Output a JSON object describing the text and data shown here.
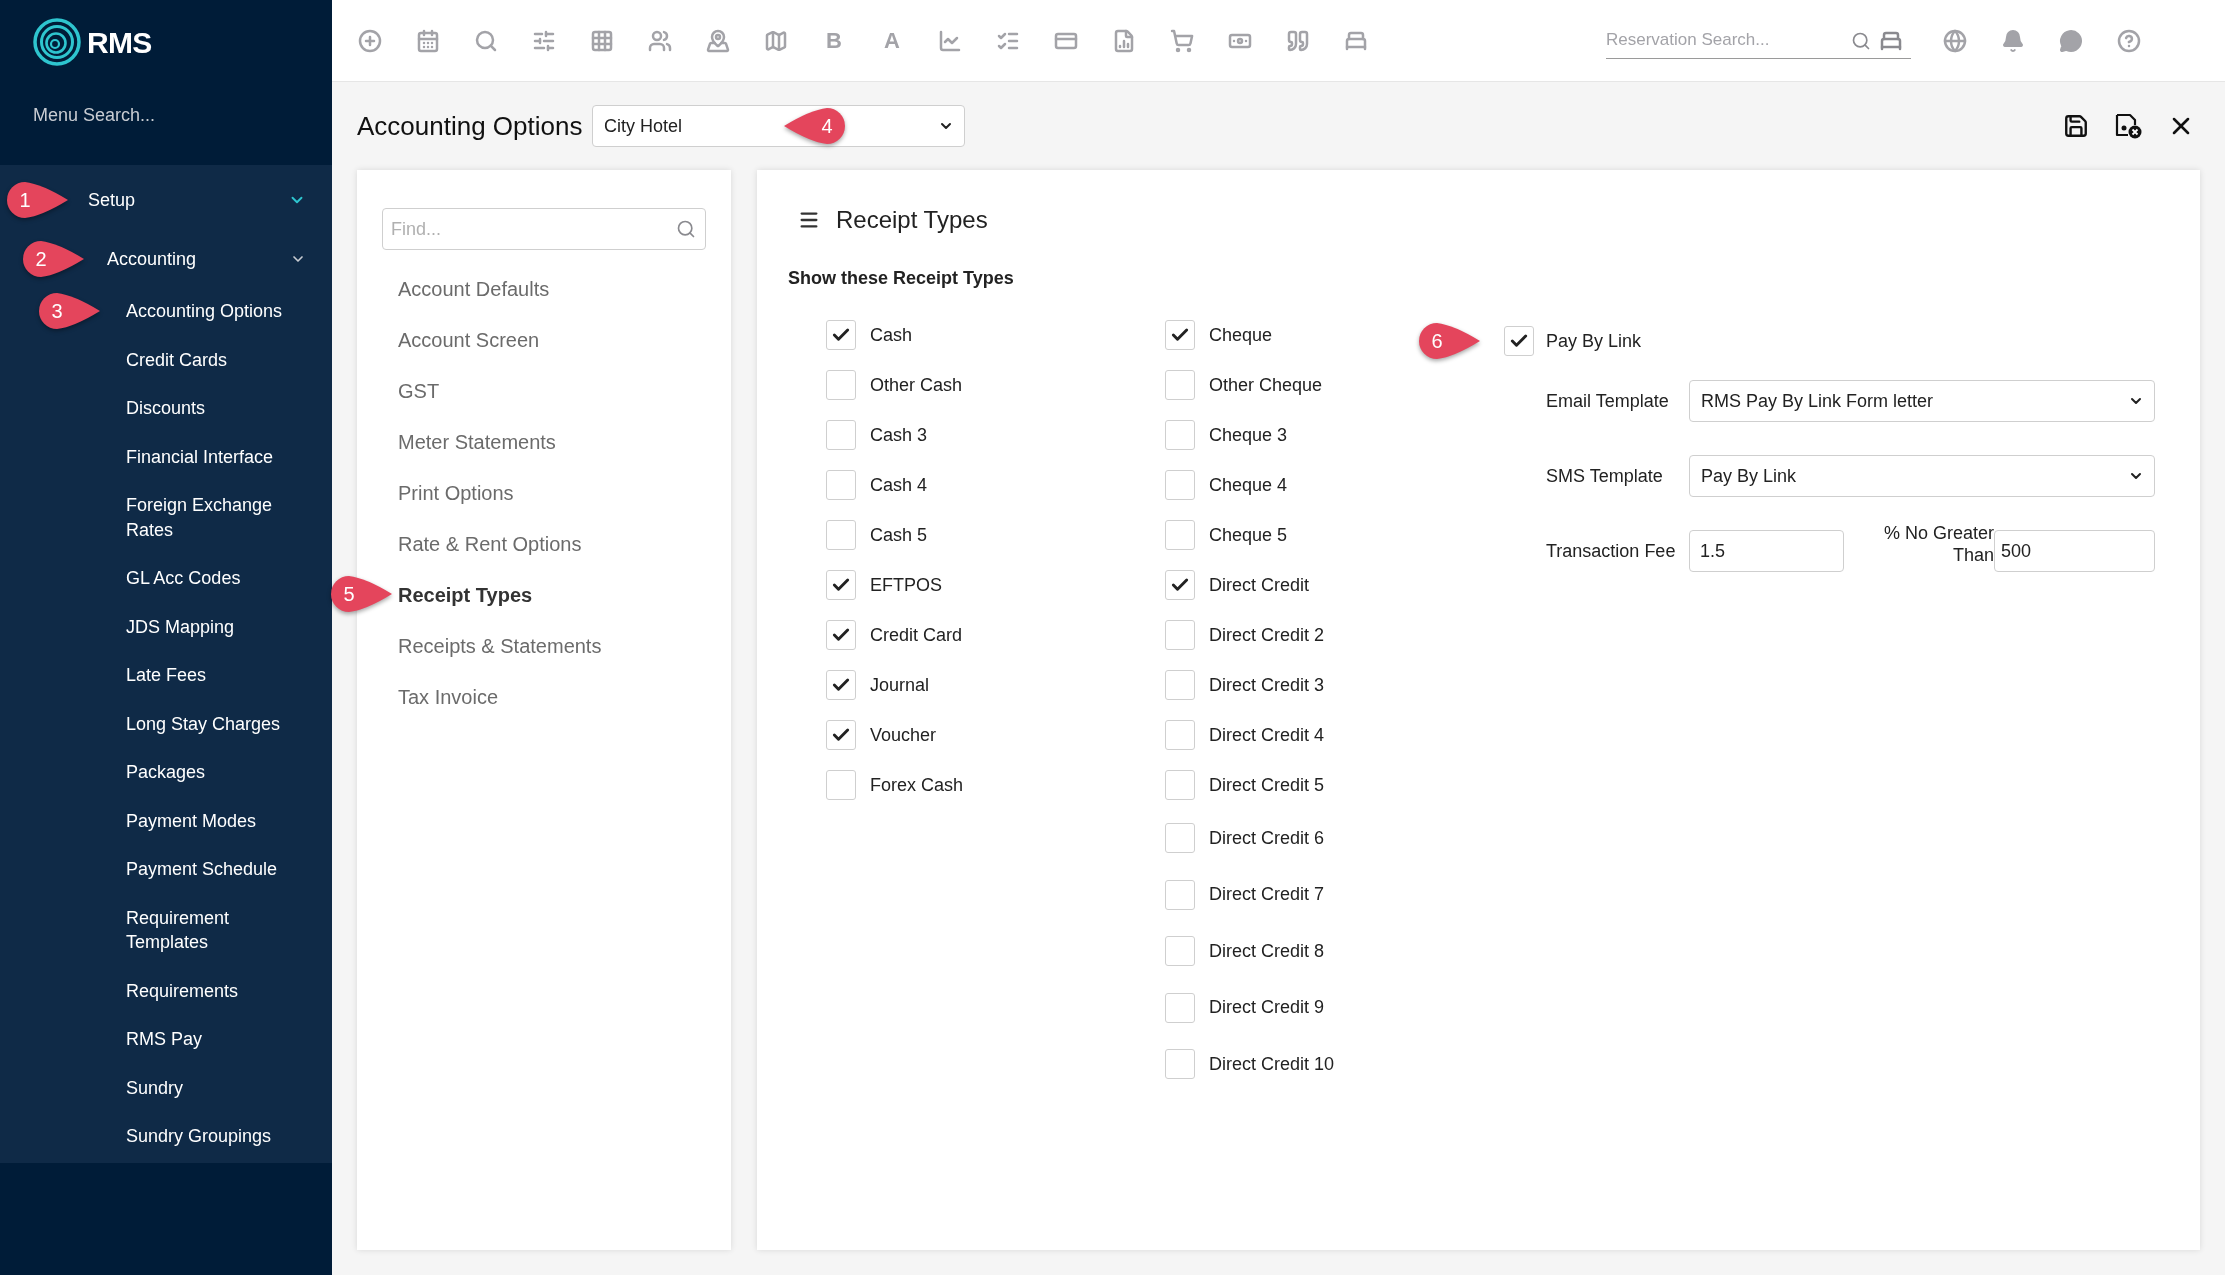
{
  "app": {
    "logo_text": "RMS",
    "menu_search": {
      "placeholder": "Menu Search..."
    }
  },
  "sidebar": {
    "items": [
      {
        "label": "Setup",
        "expanded": true,
        "callout": "1",
        "children": [
          {
            "label": "Accounting",
            "expanded": true,
            "callout": "2",
            "children": [
              {
                "label": "Accounting Options",
                "callout": "3"
              },
              {
                "label": "Credit Cards"
              },
              {
                "label": "Discounts"
              },
              {
                "label": "Financial Interface"
              },
              {
                "label": "Foreign Exchange Rates"
              },
              {
                "label": "GL Acc Codes"
              },
              {
                "label": "JDS Mapping"
              },
              {
                "label": "Late Fees"
              },
              {
                "label": "Long Stay Charges"
              },
              {
                "label": "Packages"
              },
              {
                "label": "Payment Modes"
              },
              {
                "label": "Payment Schedule"
              },
              {
                "label": "Requirement Templates"
              },
              {
                "label": "Requirements"
              },
              {
                "label": "RMS Pay"
              },
              {
                "label": "Sundry"
              },
              {
                "label": "Sundry Groupings"
              }
            ]
          }
        ]
      }
    ]
  },
  "toolbar": {
    "items": [
      {
        "kind": "icon"
      },
      {
        "kind": "icon"
      },
      {
        "kind": "icon"
      },
      {
        "kind": "icon"
      },
      {
        "kind": "icon"
      },
      {
        "kind": "icon"
      },
      {
        "kind": "icon"
      },
      {
        "kind": "icon"
      },
      {
        "kind": "letter",
        "text": "B"
      },
      {
        "kind": "letter",
        "text": "A"
      },
      {
        "kind": "icon"
      },
      {
        "kind": "icon"
      },
      {
        "kind": "icon"
      },
      {
        "kind": "icon"
      },
      {
        "kind": "icon"
      },
      {
        "kind": "icon"
      },
      {
        "kind": "icon"
      },
      {
        "kind": "icon"
      }
    ],
    "reservation_search": {
      "placeholder": "Reservation Search..."
    }
  },
  "page": {
    "title": "Accounting Options",
    "property_select": {
      "value": "City Hotel",
      "callout": "4"
    }
  },
  "options_nav": {
    "search": {
      "placeholder": "Find..."
    },
    "items": [
      {
        "label": "Account Defaults",
        "selected": false
      },
      {
        "label": "Account Screen",
        "selected": false
      },
      {
        "label": "GST",
        "selected": false
      },
      {
        "label": "Meter Statements",
        "selected": false
      },
      {
        "label": "Print Options",
        "selected": false
      },
      {
        "label": "Rate & Rent Options",
        "selected": false
      },
      {
        "label": "Receipt Types",
        "selected": true,
        "callout": "5"
      },
      {
        "label": "Receipts & Statements",
        "selected": false
      },
      {
        "label": "Tax Invoice",
        "selected": false
      }
    ]
  },
  "receipt_types": {
    "title": "Receipt Types",
    "subtitle": "Show these Receipt Types",
    "columns": [
      {
        "items": [
          {
            "label": "Cash",
            "checked": true
          },
          {
            "label": "Other Cash",
            "checked": false
          },
          {
            "label": "Cash 3",
            "checked": false
          },
          {
            "label": "Cash 4",
            "checked": false
          },
          {
            "label": "Cash 5",
            "checked": false
          },
          {
            "label": "EFTPOS",
            "checked": true
          },
          {
            "label": "Credit Card",
            "checked": true
          },
          {
            "label": "Journal",
            "checked": true
          },
          {
            "label": "Voucher",
            "checked": true
          },
          {
            "label": "Forex Cash",
            "checked": false
          }
        ]
      },
      {
        "items": [
          {
            "label": "Cheque",
            "checked": true
          },
          {
            "label": "Other Cheque",
            "checked": false
          },
          {
            "label": "Cheque 3",
            "checked": false
          },
          {
            "label": "Cheque 4",
            "checked": false
          },
          {
            "label": "Cheque 5",
            "checked": false
          },
          {
            "label": "Direct Credit",
            "checked": true
          },
          {
            "label": "Direct Credit 2",
            "checked": false
          },
          {
            "label": "Direct Credit 3",
            "checked": false
          },
          {
            "label": "Direct Credit 4",
            "checked": false
          },
          {
            "label": "Direct Credit 5",
            "checked": false
          },
          {
            "label": "Direct Credit 6",
            "checked": false
          },
          {
            "label": "Direct Credit 7",
            "checked": false
          },
          {
            "label": "Direct Credit 8",
            "checked": false
          },
          {
            "label": "Direct Credit 9",
            "checked": false
          },
          {
            "label": "Direct Credit 10",
            "checked": false
          }
        ]
      }
    ]
  },
  "pay_by_link": {
    "label": "Pay By Link",
    "checked": true,
    "callout": "6",
    "email_template": {
      "label": "Email Template",
      "value": "RMS Pay By Link Form letter"
    },
    "sms_template": {
      "label": "SMS Template",
      "value": "Pay By Link"
    },
    "transaction_fee": {
      "label": "Transaction Fee",
      "value": "1.5"
    },
    "no_greater_than": {
      "label": "% No Greater Than",
      "value": "500"
    }
  }
}
